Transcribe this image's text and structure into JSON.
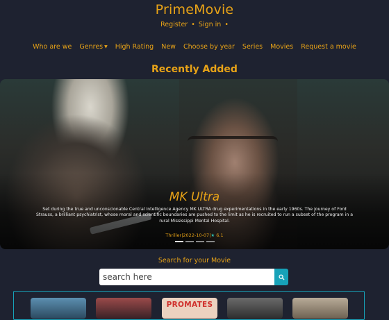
{
  "brand": {
    "title": "PrimeMovie"
  },
  "auth": {
    "register": "Register",
    "sep1": "•",
    "signin": "Sign in",
    "sep2": "•"
  },
  "nav": {
    "items": [
      {
        "label": "Who are we"
      },
      {
        "label": "Genres"
      },
      {
        "label": "High Rating"
      },
      {
        "label": "New"
      },
      {
        "label": "Choose by year"
      },
      {
        "label": "Series"
      },
      {
        "label": "Movies"
      },
      {
        "label": "Request a movie"
      }
    ]
  },
  "section": {
    "title": "Recently Added"
  },
  "hero": {
    "title": "MK Ultra",
    "description": "Set during the true and unconscionable Central Intelligence Agency MK ULTRA drug experimentations in the early 1960s. The journey of Ford Strauss, a brilliant psychiatrist, whose moral and scientific boundaries are pushed to the limit as he is recruited to run a subset of the program in a rural Mississippi Mental Hospital.",
    "genre": "Thriller",
    "date": "2022-10-07",
    "meta_sep1": "|",
    "meta_sep2": "|",
    "star": "★",
    "rating": "6.1",
    "active_slide": 1,
    "slide_count": 4
  },
  "search": {
    "label": "Search for your Movie",
    "placeholder": "search here",
    "value": ""
  },
  "posters": [
    {
      "text": ""
    },
    {
      "text": ""
    },
    {
      "text": "PROMATES"
    },
    {
      "text": ""
    },
    {
      "text": ""
    }
  ],
  "colors": {
    "accent": "#e8a317",
    "background": "#1e2230",
    "teal": "#17a2b8"
  }
}
